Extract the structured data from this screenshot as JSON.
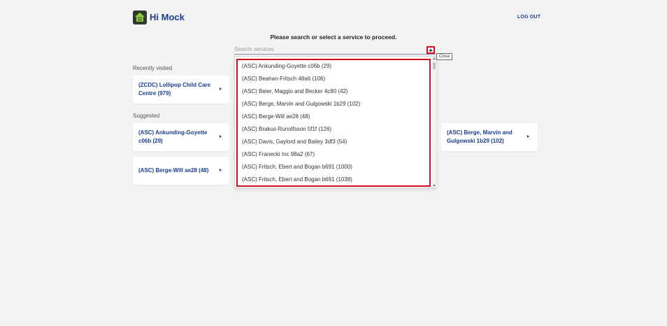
{
  "header": {
    "greeting": "Hi Mock",
    "logout_label": "LOG OUT",
    "logo_icon": "house-logo-icon"
  },
  "main": {
    "prompt": "Please search or select a service to proceed.",
    "search": {
      "placeholder": "Search services",
      "value": ""
    },
    "toggle_icon": "chevron-up-icon",
    "close_tooltip": "Close"
  },
  "recently_visited": {
    "label": "Recently visited",
    "items": [
      {
        "label": "(ZCDC) Lollipop Child Care Centre (979)"
      }
    ]
  },
  "suggested": {
    "label": "Suggested",
    "items": [
      {
        "label": "(ASC) Ankunding-Goyette c06b (29)"
      },
      {
        "label": "(ASC) Berge-Will ae28 (48)"
      },
      {
        "label": "(ASC) Berge, Marvin and Gulgowski 1b29 (102)"
      }
    ]
  },
  "dropdown": {
    "options": [
      "(ASC) Ankunding-Goyette c06b (29)",
      "(ASC) Beahan-Fritsch 48a6 (106)",
      "(ASC) Beier, Maggio and Becker 4c80 (42)",
      "(ASC) Berge, Marvin and Gulgowski 1b29 (102)",
      "(ASC) Berge-Will ae28 (48)",
      "(ASC) Brakus-Runolfsson 5f1f (126)",
      "(ASC) Davis, Gaylord and Bailey 3df3 (54)",
      "(ASC) Franecki Inc 98a2 (67)",
      "(ASC) Fritsch, Ebert and Bogan b691 (1000)",
      "(ASC) Fritsch, Ebert and Bogan b691 (1038)"
    ]
  },
  "colors": {
    "accent": "#1a3d8f",
    "highlight": "#d0101f",
    "background": "#f3f3f3"
  }
}
